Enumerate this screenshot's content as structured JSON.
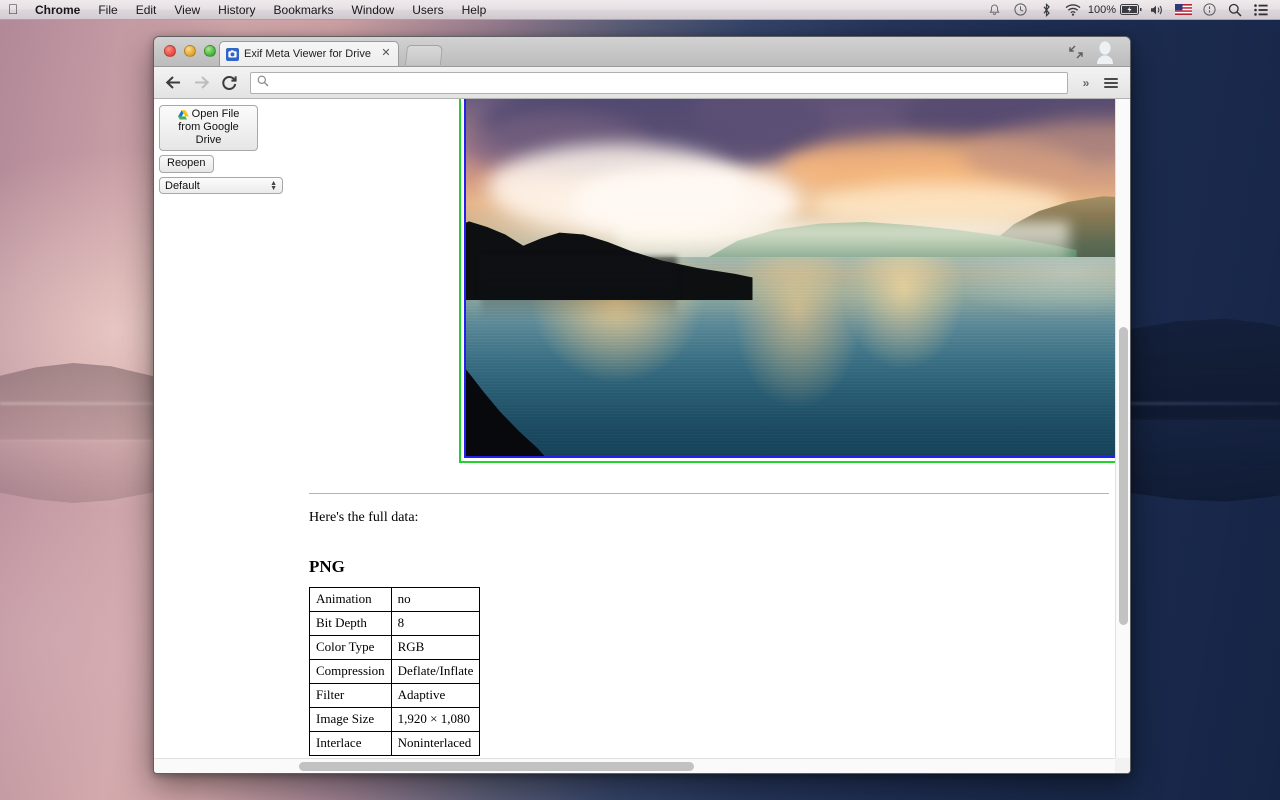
{
  "menubar": {
    "apple_icon": "apple-logo",
    "items": [
      {
        "label": "Chrome",
        "bold": true
      },
      {
        "label": "File",
        "bold": false
      },
      {
        "label": "Edit",
        "bold": false
      },
      {
        "label": "View",
        "bold": false
      },
      {
        "label": "History",
        "bold": false
      },
      {
        "label": "Bookmarks",
        "bold": false
      },
      {
        "label": "Window",
        "bold": false
      },
      {
        "label": "Users",
        "bold": false
      },
      {
        "label": "Help",
        "bold": false
      }
    ],
    "tray": {
      "battery_percent": "100%",
      "icons": [
        "bell-icon",
        "clock-icon",
        "bluetooth-icon",
        "wifi-icon",
        "battery-icon",
        "volume-icon",
        "us-flag-icon",
        "siri-icon",
        "spotlight-search-icon",
        "notification-center-icon"
      ]
    }
  },
  "window": {
    "traffic_lights": [
      "close-button",
      "minimize-button",
      "zoom-button"
    ],
    "tab": {
      "title": "Exif Meta Viewer for Drive",
      "favicon": "camera-icon",
      "close_icon": "close-icon"
    },
    "new_tab_label": "",
    "maximize_icon": "fullscreen-icon",
    "avatar_icon": "user-avatar-icon"
  },
  "toolbar": {
    "back_icon": "back-arrow-icon",
    "forward_icon": "forward-arrow-icon",
    "reload_icon": "reload-icon",
    "omnibox_value": "",
    "omnibox_placeholder": "",
    "omnibox_icon": "search-icon",
    "overflow_label": "»",
    "menu_icon": "hamburger-menu-icon"
  },
  "sidebar": {
    "open_file_line1": "Open File",
    "open_file_line2": "from Google Drive",
    "drive_icon": "google-drive-icon",
    "reopen_label": "Reopen",
    "preset_selected": "Default",
    "preset_arrows_icon": "stepper-arrows-icon"
  },
  "page": {
    "image_alt": "sunset-lake-photo",
    "frame_outer_color": "#22d22c",
    "frame_inner_color": "#2222ee",
    "intro_text": "Here's the full data:",
    "section_heading": "PNG",
    "table_rows": [
      {
        "key": "Animation",
        "value": "no"
      },
      {
        "key": "Bit Depth",
        "value": "8"
      },
      {
        "key": "Color Type",
        "value": "RGB"
      },
      {
        "key": "Compression",
        "value": "Deflate/Inflate"
      },
      {
        "key": "Filter",
        "value": "Adaptive"
      },
      {
        "key": "Image Size",
        "value": "1,920 × 1,080"
      },
      {
        "key": "Interlace",
        "value": "Noninterlaced"
      }
    ]
  },
  "scrollbars": {
    "vertical_icon": "vertical-scrollbar",
    "horizontal_icon": "horizontal-scrollbar"
  }
}
